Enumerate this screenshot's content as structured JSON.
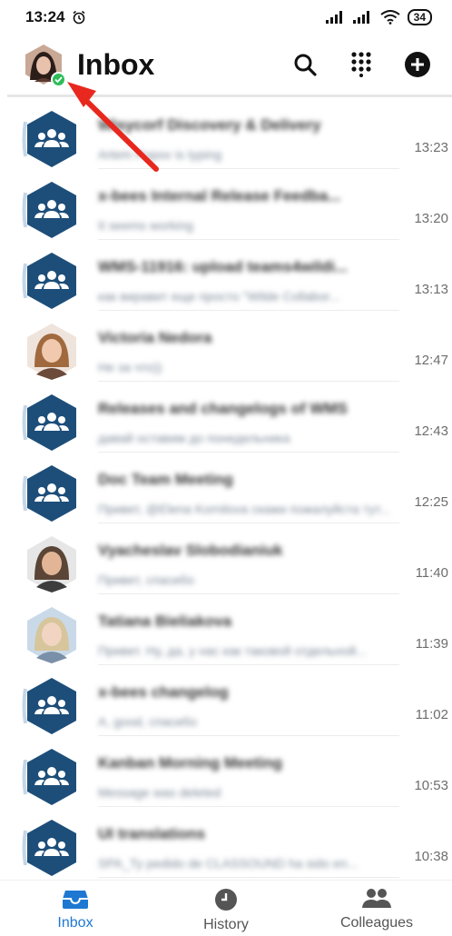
{
  "status_bar": {
    "time": "13:24",
    "battery": "34",
    "icons": [
      "alarm-icon",
      "signal-icon",
      "signal-icon",
      "wifi-icon",
      "battery-icon"
    ]
  },
  "header": {
    "title": "Inbox",
    "actions": [
      "search-icon",
      "dialpad-icon",
      "add-icon"
    ]
  },
  "colors": {
    "group_avatar": "#1d4e79",
    "accent": "#1e78d2",
    "online": "#2ebd5a",
    "annotation": "#e8281e"
  },
  "chats": [
    {
      "title": "Wisycorf Discovery & Delivery",
      "preview": "Artem Popov is typing",
      "time": "13:23",
      "avatar": "group-icon"
    },
    {
      "title": "x-bees Internal Release Feedba...",
      "preview": "It seems working",
      "time": "13:20",
      "avatar": "group-icon"
    },
    {
      "title": "WMS-11916: upload teams4wildi...",
      "preview": "как виравит еще просто \"Wilde Collabor...",
      "time": "13:13",
      "avatar": "group-icon"
    },
    {
      "title": "Victoria Nedora",
      "preview": "Не за что))",
      "time": "12:47",
      "avatar": "person-photo"
    },
    {
      "title": "Releases and changelogs of WMS",
      "preview": "давай оставим до понедельника",
      "time": "12:43",
      "avatar": "group-icon"
    },
    {
      "title": "Doc Team Meeting",
      "preview": "Привет, @Elena Kornilova скажи пожалуйста тут...",
      "time": "12:25",
      "avatar": "group-icon"
    },
    {
      "title": "Vyacheslav Slobodianiuk",
      "preview": "Привет, спасибо",
      "time": "11:40",
      "avatar": "person-photo"
    },
    {
      "title": "Tatiana Bieliakova",
      "preview": "Привет. Ну, да, у нас как таковой отдельной...",
      "time": "11:39",
      "avatar": "person-photo"
    },
    {
      "title": "x-bees changelog",
      "preview": "A, good, спасибо",
      "time": "11:02",
      "avatar": "group-icon"
    },
    {
      "title": "Kanban Morning Meeting",
      "preview": "Message was deleted",
      "time": "10:53",
      "avatar": "group-icon"
    },
    {
      "title": "UI translations",
      "preview": "SPA_Ту pedido de CLASSOUND ha sido en...",
      "time": "10:38",
      "avatar": "group-icon"
    }
  ],
  "bottom_nav": [
    {
      "label": "Inbox",
      "icon": "inbox-icon",
      "active": true
    },
    {
      "label": "History",
      "icon": "clock-icon",
      "active": false
    },
    {
      "label": "Colleagues",
      "icon": "people-icon",
      "active": false
    }
  ]
}
